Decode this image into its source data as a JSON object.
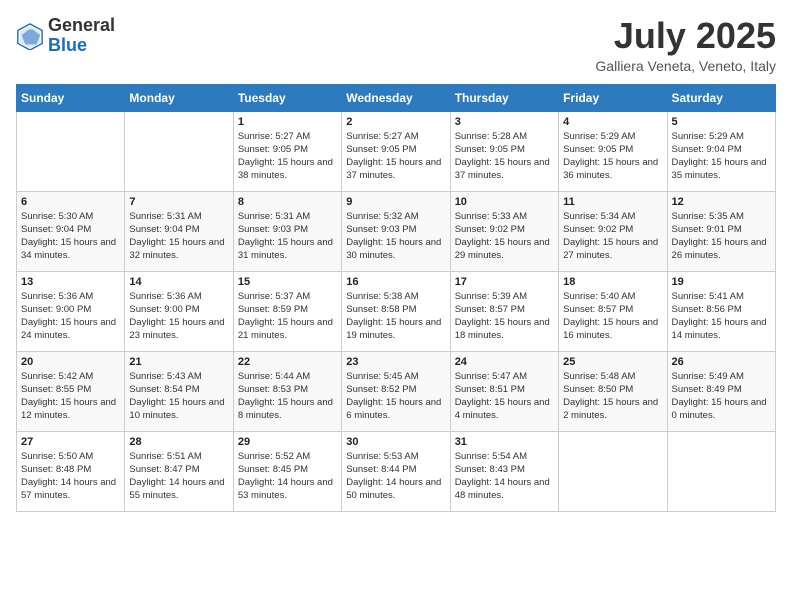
{
  "header": {
    "logo_general": "General",
    "logo_blue": "Blue",
    "month_title": "July 2025",
    "location": "Galliera Veneta, Veneto, Italy"
  },
  "weekdays": [
    "Sunday",
    "Monday",
    "Tuesday",
    "Wednesday",
    "Thursday",
    "Friday",
    "Saturday"
  ],
  "weeks": [
    [
      {
        "day": "",
        "info": ""
      },
      {
        "day": "",
        "info": ""
      },
      {
        "day": "1",
        "info": "Sunrise: 5:27 AM\nSunset: 9:05 PM\nDaylight: 15 hours and 38 minutes."
      },
      {
        "day": "2",
        "info": "Sunrise: 5:27 AM\nSunset: 9:05 PM\nDaylight: 15 hours and 37 minutes."
      },
      {
        "day": "3",
        "info": "Sunrise: 5:28 AM\nSunset: 9:05 PM\nDaylight: 15 hours and 37 minutes."
      },
      {
        "day": "4",
        "info": "Sunrise: 5:29 AM\nSunset: 9:05 PM\nDaylight: 15 hours and 36 minutes."
      },
      {
        "day": "5",
        "info": "Sunrise: 5:29 AM\nSunset: 9:04 PM\nDaylight: 15 hours and 35 minutes."
      }
    ],
    [
      {
        "day": "6",
        "info": "Sunrise: 5:30 AM\nSunset: 9:04 PM\nDaylight: 15 hours and 34 minutes."
      },
      {
        "day": "7",
        "info": "Sunrise: 5:31 AM\nSunset: 9:04 PM\nDaylight: 15 hours and 32 minutes."
      },
      {
        "day": "8",
        "info": "Sunrise: 5:31 AM\nSunset: 9:03 PM\nDaylight: 15 hours and 31 minutes."
      },
      {
        "day": "9",
        "info": "Sunrise: 5:32 AM\nSunset: 9:03 PM\nDaylight: 15 hours and 30 minutes."
      },
      {
        "day": "10",
        "info": "Sunrise: 5:33 AM\nSunset: 9:02 PM\nDaylight: 15 hours and 29 minutes."
      },
      {
        "day": "11",
        "info": "Sunrise: 5:34 AM\nSunset: 9:02 PM\nDaylight: 15 hours and 27 minutes."
      },
      {
        "day": "12",
        "info": "Sunrise: 5:35 AM\nSunset: 9:01 PM\nDaylight: 15 hours and 26 minutes."
      }
    ],
    [
      {
        "day": "13",
        "info": "Sunrise: 5:36 AM\nSunset: 9:00 PM\nDaylight: 15 hours and 24 minutes."
      },
      {
        "day": "14",
        "info": "Sunrise: 5:36 AM\nSunset: 9:00 PM\nDaylight: 15 hours and 23 minutes."
      },
      {
        "day": "15",
        "info": "Sunrise: 5:37 AM\nSunset: 8:59 PM\nDaylight: 15 hours and 21 minutes."
      },
      {
        "day": "16",
        "info": "Sunrise: 5:38 AM\nSunset: 8:58 PM\nDaylight: 15 hours and 19 minutes."
      },
      {
        "day": "17",
        "info": "Sunrise: 5:39 AM\nSunset: 8:57 PM\nDaylight: 15 hours and 18 minutes."
      },
      {
        "day": "18",
        "info": "Sunrise: 5:40 AM\nSunset: 8:57 PM\nDaylight: 15 hours and 16 minutes."
      },
      {
        "day": "19",
        "info": "Sunrise: 5:41 AM\nSunset: 8:56 PM\nDaylight: 15 hours and 14 minutes."
      }
    ],
    [
      {
        "day": "20",
        "info": "Sunrise: 5:42 AM\nSunset: 8:55 PM\nDaylight: 15 hours and 12 minutes."
      },
      {
        "day": "21",
        "info": "Sunrise: 5:43 AM\nSunset: 8:54 PM\nDaylight: 15 hours and 10 minutes."
      },
      {
        "day": "22",
        "info": "Sunrise: 5:44 AM\nSunset: 8:53 PM\nDaylight: 15 hours and 8 minutes."
      },
      {
        "day": "23",
        "info": "Sunrise: 5:45 AM\nSunset: 8:52 PM\nDaylight: 15 hours and 6 minutes."
      },
      {
        "day": "24",
        "info": "Sunrise: 5:47 AM\nSunset: 8:51 PM\nDaylight: 15 hours and 4 minutes."
      },
      {
        "day": "25",
        "info": "Sunrise: 5:48 AM\nSunset: 8:50 PM\nDaylight: 15 hours and 2 minutes."
      },
      {
        "day": "26",
        "info": "Sunrise: 5:49 AM\nSunset: 8:49 PM\nDaylight: 15 hours and 0 minutes."
      }
    ],
    [
      {
        "day": "27",
        "info": "Sunrise: 5:50 AM\nSunset: 8:48 PM\nDaylight: 14 hours and 57 minutes."
      },
      {
        "day": "28",
        "info": "Sunrise: 5:51 AM\nSunset: 8:47 PM\nDaylight: 14 hours and 55 minutes."
      },
      {
        "day": "29",
        "info": "Sunrise: 5:52 AM\nSunset: 8:45 PM\nDaylight: 14 hours and 53 minutes."
      },
      {
        "day": "30",
        "info": "Sunrise: 5:53 AM\nSunset: 8:44 PM\nDaylight: 14 hours and 50 minutes."
      },
      {
        "day": "31",
        "info": "Sunrise: 5:54 AM\nSunset: 8:43 PM\nDaylight: 14 hours and 48 minutes."
      },
      {
        "day": "",
        "info": ""
      },
      {
        "day": "",
        "info": ""
      }
    ]
  ]
}
